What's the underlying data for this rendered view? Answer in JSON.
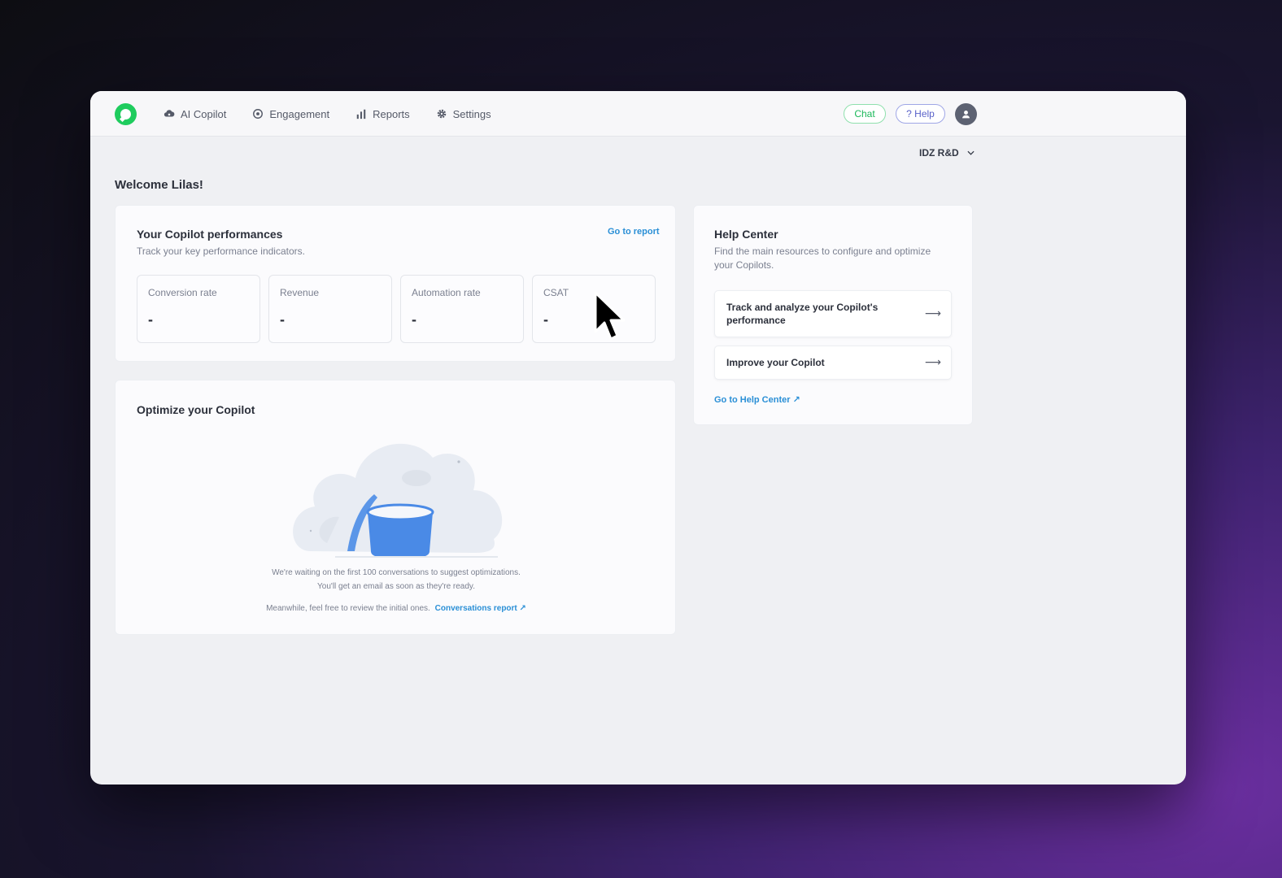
{
  "nav": {
    "items": [
      {
        "label": "AI Copilot",
        "icon": "cloud-icon"
      },
      {
        "label": "Engagement",
        "icon": "target-icon"
      },
      {
        "label": "Reports",
        "icon": "bar-chart-icon"
      },
      {
        "label": "Settings",
        "icon": "gear-icon"
      }
    ],
    "chat_label": "Chat",
    "help_label": "? Help"
  },
  "workspace": {
    "name": "IDZ R&D"
  },
  "welcome": "Welcome Lilas!",
  "performance": {
    "title": "Your Copilot performances",
    "subtitle": "Track your key performance indicators.",
    "report_link": "Go to report",
    "kpis": [
      {
        "label": "Conversion rate",
        "value": "-"
      },
      {
        "label": "Revenue",
        "value": "-"
      },
      {
        "label": "Automation rate",
        "value": "-"
      },
      {
        "label": "CSAT",
        "value": "-"
      }
    ]
  },
  "optimize": {
    "title": "Optimize your Copilot",
    "line1": "We're waiting on the first 100 conversations to suggest optimizations.",
    "line2": "You'll get an email as soon as they're ready.",
    "line3": "Meanwhile, feel free to review the initial ones.",
    "link": "Conversations report ↗"
  },
  "help_center": {
    "title": "Help Center",
    "subtitle": "Find the main resources to configure and optimize your Copilots.",
    "items": [
      {
        "label": "Track and analyze your Copilot's performance"
      },
      {
        "label": "Improve your Copilot"
      }
    ],
    "link": "Go to Help Center ↗"
  },
  "colors": {
    "brand_green": "#1fcc5e",
    "link_blue": "#2a8fd6",
    "help_purple": "#5a62c9"
  }
}
